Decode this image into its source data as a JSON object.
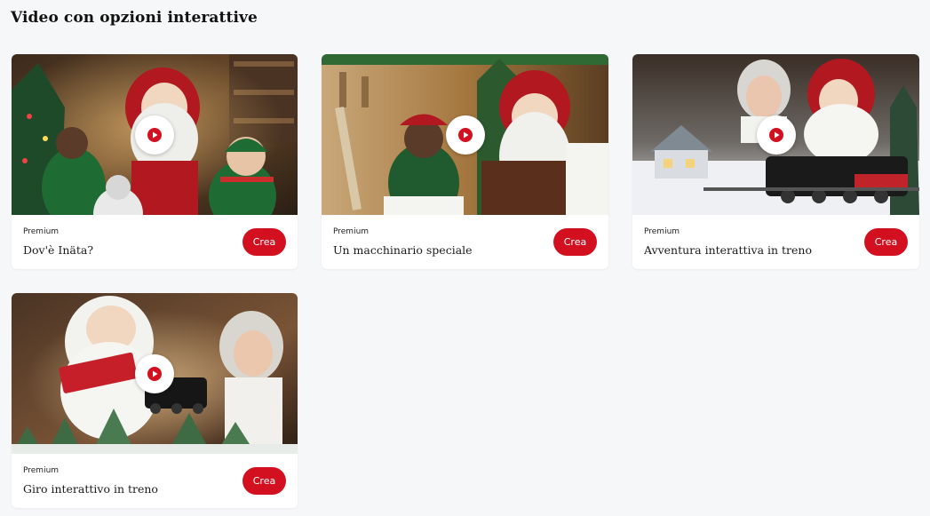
{
  "section": {
    "title": "Video con opzioni interattive"
  },
  "colors": {
    "accent": "#d3101f",
    "background": "#f6f7f9",
    "card": "#ffffff"
  },
  "cards": [
    {
      "badge": "Premium",
      "title": "Dov'è Inäta?",
      "cta": "Crea",
      "icon": "play-icon"
    },
    {
      "badge": "Premium",
      "title": "Un macchinario speciale",
      "cta": "Crea",
      "icon": "play-icon"
    },
    {
      "badge": "Premium",
      "title": "Avventura interattiva in treno",
      "cta": "Crea",
      "icon": "play-icon"
    },
    {
      "badge": "Premium",
      "title": "Giro interattivo in treno",
      "cta": "Crea",
      "icon": "play-icon"
    }
  ]
}
